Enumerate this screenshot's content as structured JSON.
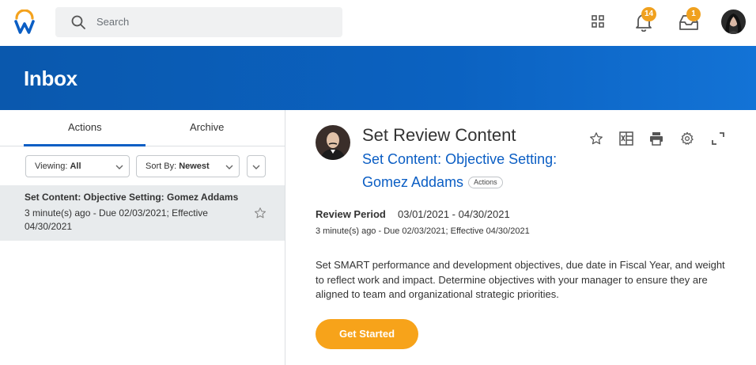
{
  "header": {
    "search_placeholder": "Search",
    "notifications_count": "14",
    "inbox_count": "1",
    "accent": "#f0a11f"
  },
  "banner": {
    "title": "Inbox",
    "color": "#0b5ec4"
  },
  "left": {
    "tabs": [
      {
        "label": "Actions",
        "active": true
      },
      {
        "label": "Archive",
        "active": false
      }
    ],
    "filters": {
      "viewing_label": "Viewing:",
      "viewing_value": "All",
      "sort_label": "Sort By:",
      "sort_value": "Newest"
    },
    "items": [
      {
        "title": "Set Content: Objective Setting: Gomez Addams",
        "subtitle": "3 minute(s) ago - Due 02/03/2021; Effective 04/30/2021"
      }
    ]
  },
  "detail": {
    "title": "Set Review Content",
    "subtitle": "Set Content: Objective Setting: Gomez Addams",
    "actions_pill": "Actions",
    "review_period_label": "Review Period",
    "review_period_value": "03/01/2021 - 04/30/2021",
    "meta": "3 minute(s) ago - Due 02/03/2021; Effective 04/30/2021",
    "description": "Set SMART performance and development objectives, due date in Fiscal Year, and weight to reflect work and impact. Determine objectives with your manager to ensure they are aligned to team and organizational strategic priorities.",
    "button_label": "Get Started",
    "button_color": "#f7a31a"
  },
  "icons": [
    "workday-logo",
    "search-icon",
    "apps-grid-icon",
    "bell-icon",
    "inbox-tray-icon",
    "star-icon",
    "excel-icon",
    "print-icon",
    "gear-icon",
    "expand-icon",
    "chevron-down-icon"
  ]
}
